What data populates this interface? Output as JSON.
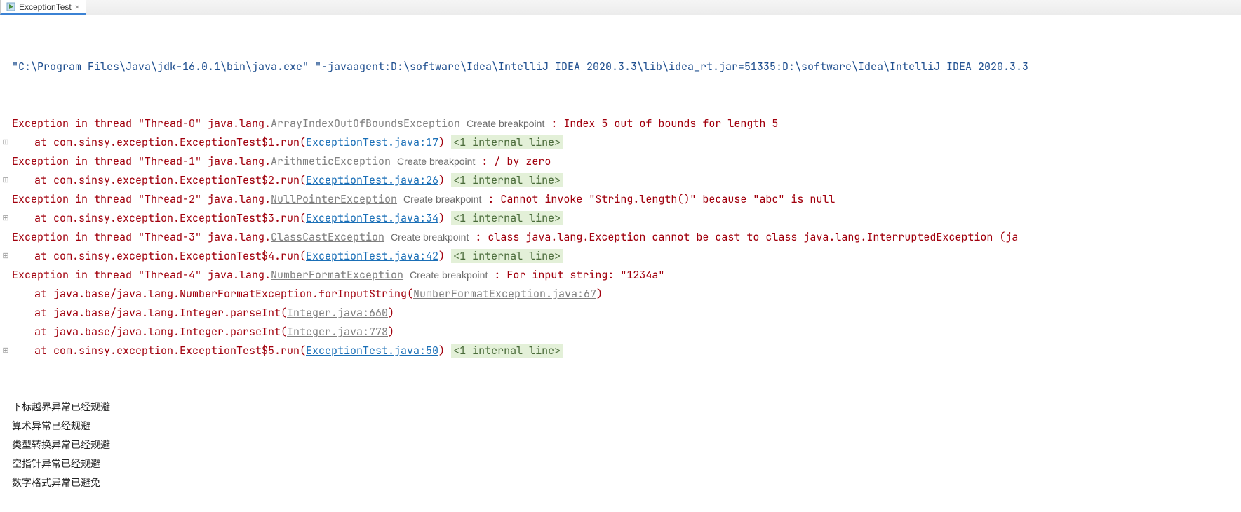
{
  "tab": {
    "label": "ExceptionTest",
    "close": "×"
  },
  "command": "\"C:\\Program Files\\Java\\jdk-16.0.1\\bin\\java.exe\" \"-javaagent:D:\\software\\Idea\\IntelliJ IDEA 2020.3.3\\lib\\idea_rt.jar=51335:D:\\software\\Idea\\IntelliJ IDEA 2020.3.3",
  "create_bp": "Create breakpoint",
  "internal_line": "<1 internal line>",
  "exceptions": [
    {
      "prefix": "Exception in thread \"Thread-0\" java.lang.",
      "type": "ArrayIndexOutOfBoundsException",
      "msg": ": Index 5 out of bounds for length 5",
      "frames": [
        {
          "pre": "at com.sinsy.exception.ExceptionTest$1.run(",
          "link": "ExceptionTest.java:17",
          "linkType": "blue",
          "post": ")",
          "gutter": "⊞",
          "badge": true
        }
      ]
    },
    {
      "prefix": "Exception in thread \"Thread-1\" java.lang.",
      "type": "ArithmeticException",
      "msg": ": / by zero",
      "frames": [
        {
          "pre": "at com.sinsy.exception.ExceptionTest$2.run(",
          "link": "ExceptionTest.java:26",
          "linkType": "blue",
          "post": ")",
          "gutter": "⊞",
          "badge": true
        }
      ]
    },
    {
      "prefix": "Exception in thread \"Thread-2\" java.lang.",
      "type": "NullPointerException",
      "msg": ": Cannot invoke \"String.length()\" because \"abc\" is null",
      "frames": [
        {
          "pre": "at com.sinsy.exception.ExceptionTest$3.run(",
          "link": "ExceptionTest.java:34",
          "linkType": "blue",
          "post": ")",
          "gutter": "⊞",
          "badge": true
        }
      ]
    },
    {
      "prefix": "Exception in thread \"Thread-3\" java.lang.",
      "type": "ClassCastException",
      "msg": ": class java.lang.Exception cannot be cast to class java.lang.InterruptedException (ja",
      "frames": [
        {
          "pre": "at com.sinsy.exception.ExceptionTest$4.run(",
          "link": "ExceptionTest.java:42",
          "linkType": "blue",
          "post": ")",
          "gutter": "⊞",
          "badge": true
        }
      ]
    },
    {
      "prefix": "Exception in thread \"Thread-4\" java.lang.",
      "type": "NumberFormatException",
      "msg": ": For input string: \"1234a\"",
      "frames": [
        {
          "pre": "at java.base/java.lang.NumberFormatException.forInputString(",
          "link": "NumberFormatException.java:67",
          "linkType": "grey",
          "post": ")",
          "gutter": "",
          "badge": false
        },
        {
          "pre": "at java.base/java.lang.Integer.parseInt(",
          "link": "Integer.java:660",
          "linkType": "grey",
          "post": ")",
          "gutter": "",
          "badge": false
        },
        {
          "pre": "at java.base/java.lang.Integer.parseInt(",
          "link": "Integer.java:778",
          "linkType": "grey",
          "post": ")",
          "gutter": "",
          "badge": false
        },
        {
          "pre": "at com.sinsy.exception.ExceptionTest$5.run(",
          "link": "ExceptionTest.java:50",
          "linkType": "blue",
          "post": ")",
          "gutter": "⊞",
          "badge": true
        }
      ]
    }
  ],
  "messages": [
    "下标越界异常已经规避",
    "算术异常已经规避",
    "类型转换异常已经规避",
    "空指针异常已经规避",
    "数字格式异常已避免"
  ]
}
